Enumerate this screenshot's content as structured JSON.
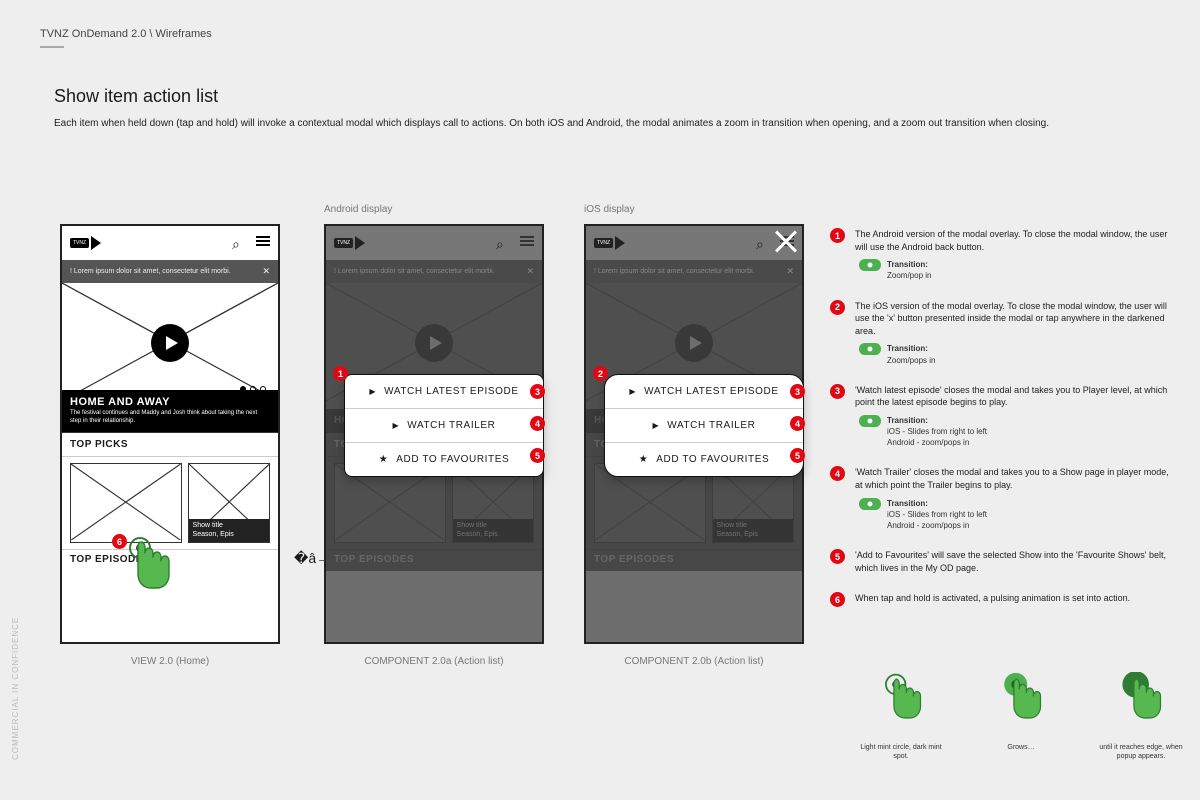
{
  "breadcrumb": "TVNZ OnDemand 2.0 \\ Wireframes",
  "side_tag": "COMMERCIAL IN CONFIDENCE",
  "page_title": "Show item action list",
  "intro": "Each item when held down (tap and hold) will invoke a contextual modal which displays call to actions. On both iOS and Android, the modal animates a zoom in transition when opening, and a zoom out transition when closing.",
  "labels": {
    "android": "Android display",
    "ios": "iOS display"
  },
  "captions": {
    "view": "VIEW 2.0 (Home)",
    "compA": "COMPONENT 2.0a (Action list)",
    "compB": "COMPONENT 2.0b (Action list)"
  },
  "alert_text": "!   Lorem ipsum dolor sit amet, consectetur elit morbi.",
  "hero": {
    "title": "HOME AND AWAY",
    "sub": "The festival continues and Maddy and Josh think about taking the next step in their relationship."
  },
  "belts": {
    "top_picks": "TOP PICKS",
    "top_episodes": "TOP EPISODES"
  },
  "tile_meta": {
    "l1": "Show title",
    "l2": "Season, Epis"
  },
  "actions": {
    "watch_latest": "WATCH LATEST EPISODE",
    "watch_trailer": "WATCH TRAILER",
    "add_fav": "ADD TO FAVOURITES"
  },
  "legend": [
    {
      "n": "1",
      "body": "The Android version of the modal overlay. To close the modal window, the user will use the Android back button.",
      "trans_label": "Transition:",
      "trans_body": "Zoom/pop in"
    },
    {
      "n": "2",
      "body": "The iOS version of the modal overlay.  To close the modal window, the user will use the 'x' button presented inside the modal or tap anywhere in the darkened area.",
      "trans_label": "Transition:",
      "trans_body": "Zoom/pops in"
    },
    {
      "n": "3",
      "body": "'Watch latest episode' closes the modal and takes you to Player level, at which point the latest episode begins to play.",
      "trans_label": "Transition:",
      "trans_body": "iOS - Slides from right to left\nAndroid - zoom/pops in"
    },
    {
      "n": "4",
      "body": "'Watch Trailer' closes the modal and takes you to a Show page in player mode, at which point the Trailer begins to play.",
      "trans_label": "Transition:",
      "trans_body": "iOS - Slides from right to left\nAndroid - zoom/pops in"
    },
    {
      "n": "5",
      "body": "'Add to Favourites' will save the selected Show into the 'Favourite Shows' belt, which lives in the My OD page."
    },
    {
      "n": "6",
      "body": "When tap and hold is activated, a pulsing animation is set into action."
    }
  ],
  "hand_captions": {
    "a": "Light mint circle, dark mint spot.",
    "b": "Grows…",
    "c": "until it reaches edge, when popup appears."
  }
}
